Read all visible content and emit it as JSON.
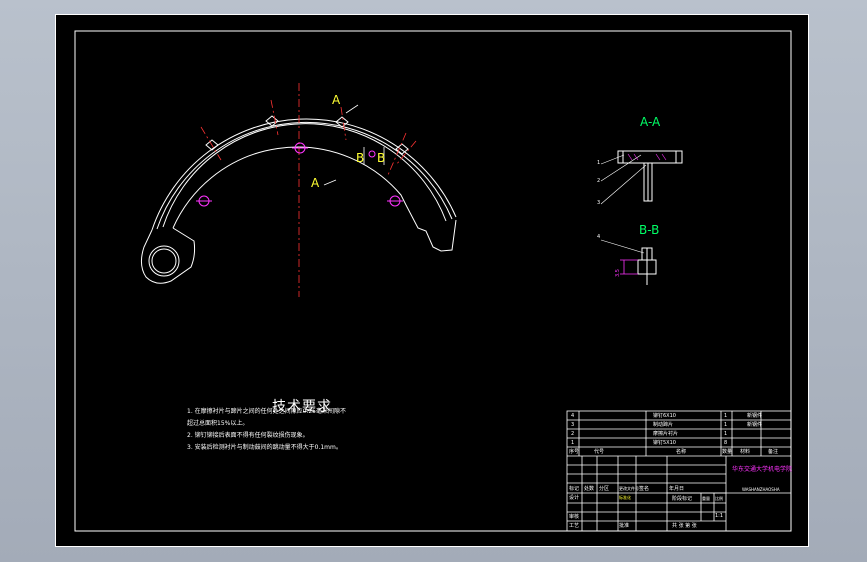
{
  "drawing": {
    "section_labels": {
      "aa_title": "A-A",
      "bb_title": "B-B",
      "a_top": "A",
      "a_bottom": "A",
      "b_left": "B",
      "b_right": "B"
    },
    "leader_numbers": [
      "1",
      "2",
      "3",
      "4"
    ],
    "dimension_text": "3.5"
  },
  "tech_requirements": {
    "title": "技术要求",
    "lines": [
      "1. 在摩擦衬片与蹄片之间的任何处之间隙应0.25毫米间隙不",
      "   超过总面积15%以上。",
      "2. 铆钉铆接后表面不得有任何裂纹损伤现象。",
      "3. 安装后检测衬片与制动鼓间的跳动量不得大于0.1mm。"
    ]
  },
  "bom": {
    "rows": [
      {
        "no": "4",
        "name": "铆钉6X10",
        "qty": "1",
        "material": "新钢件"
      },
      {
        "no": "3",
        "name": "制动蹄片",
        "qty": "1",
        "material": "新钢件"
      },
      {
        "no": "2",
        "name": "摩擦片衬片",
        "qty": "1",
        "material": ""
      },
      {
        "no": "1",
        "name": "铆钉5X10",
        "qty": "8",
        "material": ""
      }
    ],
    "header": [
      "序号",
      "代号",
      "名称",
      "数量",
      "材料",
      "备注"
    ]
  },
  "title_block": {
    "school": "华东交通大学机电学院",
    "drawing_no": "WASHANZHAOSHA",
    "labels": [
      "标记",
      "处数",
      "分区",
      "更改文件号",
      "签名",
      "年月日"
    ],
    "design": "设计",
    "standard": "标准化",
    "review": "审核",
    "process": "工艺",
    "approve": "批准",
    "stage": "阶段标记",
    "weight": "重量",
    "scale": "比例",
    "scale_value": "1:1",
    "sheet": "共 张 第 张"
  },
  "colors": {
    "background": "#000000",
    "outline": "#ffffff",
    "centerline": "#ff3333",
    "section_text": "#00ff66",
    "label_text": "#ffff33",
    "accent": "#ff33ff"
  }
}
